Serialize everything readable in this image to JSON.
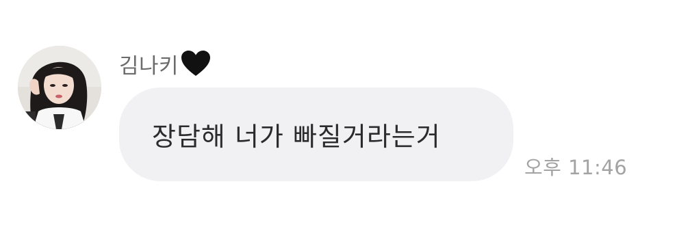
{
  "message": {
    "sender_name": "김나키",
    "sender_emoji_icon": "black-heart-icon",
    "avatar_icon": "profile-photo",
    "text": "장담해 너가 빠질거라는거",
    "time": "오후 11:46"
  },
  "colors": {
    "bubble_bg": "#f1f1f4",
    "text": "#2b2b2b",
    "sender_text": "#6b6b6b",
    "timestamp_text": "#a3a3a3",
    "heart": "#111111"
  }
}
